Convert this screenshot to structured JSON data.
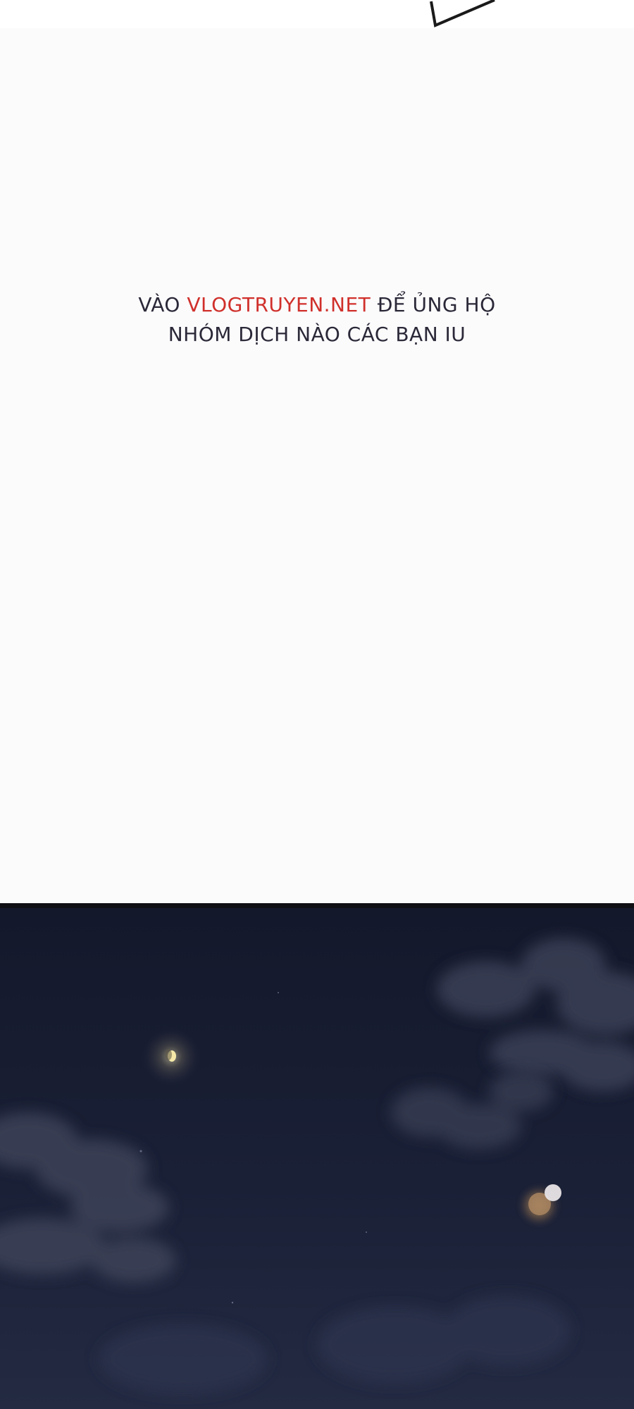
{
  "credit": {
    "line1_prefix": "VÀO",
    "line1_site": "VLOGTRUYEN.NET",
    "line1_suffix": "ĐỂ ỦNG HỘ",
    "line2": "NHÓM DỊCH NÀO CÁC BẠN IU"
  },
  "colors": {
    "background": "#fbfbfc",
    "text": "#2b2838",
    "site_link": "#d0302b",
    "night_sky": "#13162a"
  },
  "icons": {
    "moon": "crescent-moon-icon",
    "speech_tail": "speech-bubble-tail-icon"
  }
}
